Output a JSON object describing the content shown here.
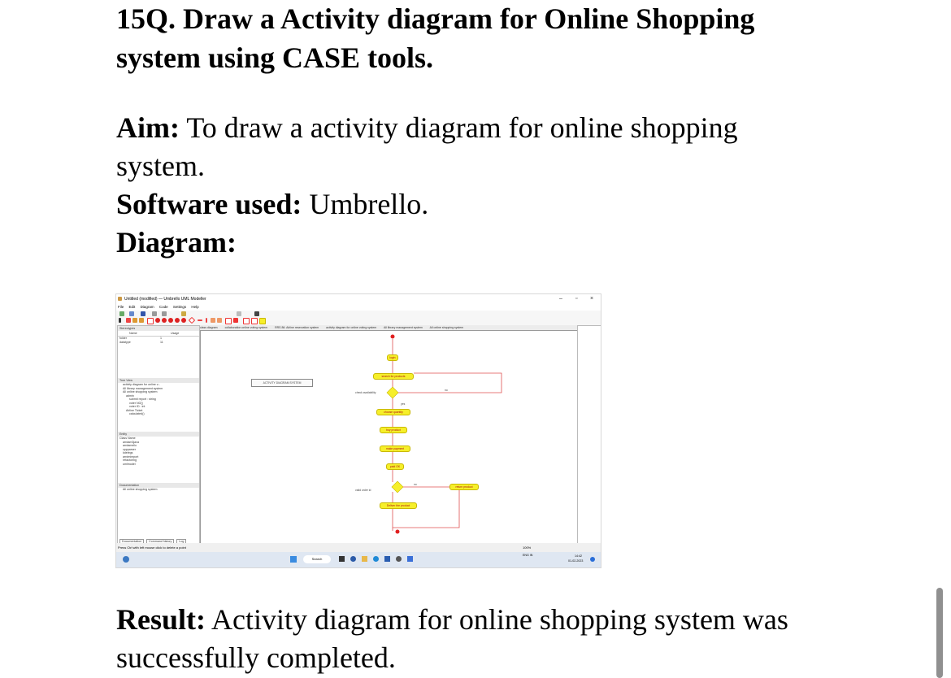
{
  "doc": {
    "heading": "15Q. Draw a Activity diagram for Online Shopping system using CASE tools.",
    "aim_label": "Aim:",
    "aim_text": " To draw a activity diagram for online shopping system.",
    "software_label": "Software used:",
    "software_text": " Umbrello.",
    "diagram_label": "Diagram:",
    "result_label": "Result:",
    "result_text": " Activity diagram for online shopping system was successfully completed."
  },
  "screenshot": {
    "window_title": "Untitled (modified) — Umbrello UML Modeller",
    "menu": [
      "File",
      "Edit",
      "Diagram",
      "Code",
      "Settings",
      "Help"
    ],
    "toolbar_labels": [
      "New",
      "Open",
      "Save",
      "Cut",
      "Copy",
      "Paste",
      "Find"
    ],
    "tabs": [
      "class diagram",
      "collaboration online voting system",
      "RRS 86: Airline reservation system",
      "activity diagram for online voting system",
      "All library management system",
      "All online shopping system"
    ],
    "stereotype_panel": {
      "header": "Stereotypes",
      "columns": [
        "Name",
        "Usage"
      ],
      "rows": [
        [
          "folder",
          "1"
        ],
        [
          "datatype",
          "11"
        ]
      ]
    },
    "tree_view": {
      "header": "Tree View",
      "items": [
        "activity diagram for online v...",
        "All library management system",
        "All online shopping system",
        "admin",
        "submit report : string",
        "voter NO()",
        "voter ID : int",
        "Airline Ticket",
        "calculated()"
      ]
    },
    "entity_panel": {
      "header": "Entity",
      "column": "Class Name",
      "items": [
        "arrdam3java",
        "arrdamello",
        "cppparser",
        "kdelegs",
        "arrdmimport",
        "refactoring",
        "umlmodel"
      ]
    },
    "documentation": {
      "header": "Documentation",
      "text": "All online shopping system"
    },
    "bottom_tabs": [
      "Documentation",
      "Command history",
      "Log"
    ],
    "status_text": "Press Ctrl with left mouse click to delete a point",
    "zoom": "100%",
    "diagram": {
      "note": "ACTIVITY DIAGRAM SYSTEM",
      "activities": [
        "login",
        "search for products",
        "choose quantity",
        "buy product",
        "make payment",
        "paid OK",
        "Deliver the product",
        "return product"
      ],
      "labels": [
        "check availability",
        "no",
        "yes",
        "valid order id",
        "no"
      ]
    },
    "taskbar": {
      "search": "Search",
      "time": "14:42",
      "date": "01-02-2023",
      "lang": "ENG IN"
    }
  }
}
